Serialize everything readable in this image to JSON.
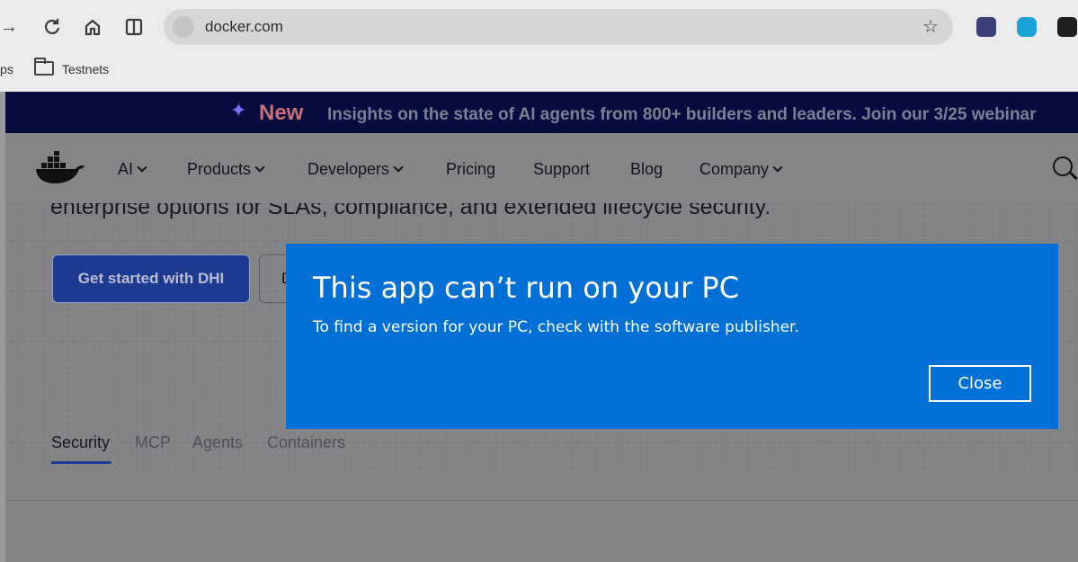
{
  "browser": {
    "url": "docker.com",
    "bookmarks": [
      {
        "label": "ps"
      },
      {
        "label": "Testnets"
      }
    ]
  },
  "banner": {
    "new_label": "New",
    "message": "Insights on the state of AI agents from 800+ builders and leaders. Join our 3/25 webinar"
  },
  "nav": {
    "items": [
      {
        "label": "AI"
      },
      {
        "label": "Products"
      },
      {
        "label": "Developers"
      },
      {
        "label": "Pricing"
      },
      {
        "label": "Support"
      },
      {
        "label": "Blog"
      },
      {
        "label": "Company"
      }
    ]
  },
  "hero": {
    "cut_text": "enterprise options for SLAs, compliance, and extended lifecycle security.",
    "primary_button": "Get started with DHI",
    "secondary_button_partial": "D"
  },
  "tabs": [
    {
      "label": "Security",
      "active": true
    },
    {
      "label": "MCP",
      "active": false
    },
    {
      "label": "Agents",
      "active": false
    },
    {
      "label": "Containers",
      "active": false
    }
  ],
  "dialog": {
    "title": "This app can’t run on your PC",
    "message": "To find a version for your PC, check with the software publisher.",
    "close_label": "Close",
    "background_color": "#0170d6"
  }
}
